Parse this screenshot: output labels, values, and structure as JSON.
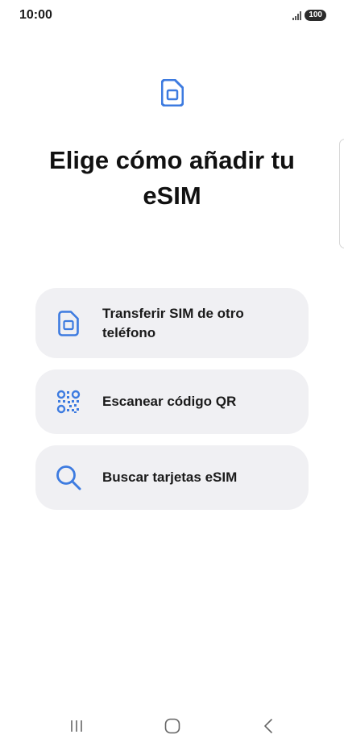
{
  "status_bar": {
    "time": "10:00",
    "battery": "100",
    "icons": [
      "signal-icon",
      "battery-icon"
    ]
  },
  "header": {
    "icon": "sim-card-icon",
    "title": "Elige cómo añadir tu eSIM"
  },
  "options": [
    {
      "label": "Transferir SIM de otro teléfono",
      "icon": "sim-card-icon"
    },
    {
      "label": "Escanear código QR",
      "icon": "qr-code-icon"
    },
    {
      "label": "Buscar tarjetas eSIM",
      "icon": "search-icon"
    }
  ],
  "nav_bar": {
    "icons": [
      "recents-icon",
      "home-icon",
      "back-icon"
    ]
  },
  "colors": {
    "accent": "#3d7be0",
    "card_background": "#f0f0f3",
    "text": "#111111",
    "background": "#ffffff"
  }
}
